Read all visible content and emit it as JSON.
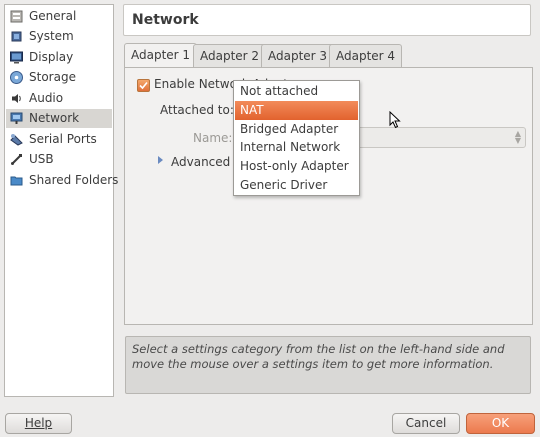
{
  "sidebar": {
    "items": [
      {
        "label": "General",
        "icon": "general-icon"
      },
      {
        "label": "System",
        "icon": "chip-icon"
      },
      {
        "label": "Display",
        "icon": "monitor-icon"
      },
      {
        "label": "Storage",
        "icon": "disc-icon"
      },
      {
        "label": "Audio",
        "icon": "speaker-icon"
      },
      {
        "label": "Network",
        "icon": "network-icon"
      },
      {
        "label": "Serial Ports",
        "icon": "serial-port-icon"
      },
      {
        "label": "USB",
        "icon": "usb-icon"
      },
      {
        "label": "Shared Folders",
        "icon": "folder-icon"
      }
    ],
    "selected": "Network"
  },
  "header": {
    "title": "Network"
  },
  "tabs": [
    {
      "label": "Adapter 1"
    },
    {
      "label": "Adapter 2"
    },
    {
      "label": "Adapter 3"
    },
    {
      "label": "Adapter 4"
    }
  ],
  "active_tab": "Adapter 1",
  "form": {
    "enable_label": "Enable Network Adapter",
    "enable_checked": true,
    "attached_label": "Attached to:",
    "name_label": "Name:",
    "name_value": "",
    "advanced_label": "Advanced"
  },
  "dropdown": {
    "options": [
      "Not attached",
      "NAT",
      "Bridged Adapter",
      "Internal Network",
      "Host-only Adapter",
      "Generic Driver"
    ],
    "highlighted": "NAT"
  },
  "info": {
    "text": "Select a settings category from the list on the left-hand side and move the mouse over a settings item to get more information."
  },
  "buttons": {
    "help": "Help",
    "cancel": "Cancel",
    "ok": "OK"
  },
  "colors": {
    "accent": "#e86b3a",
    "selected_sidebar": "#d8d6d2"
  }
}
